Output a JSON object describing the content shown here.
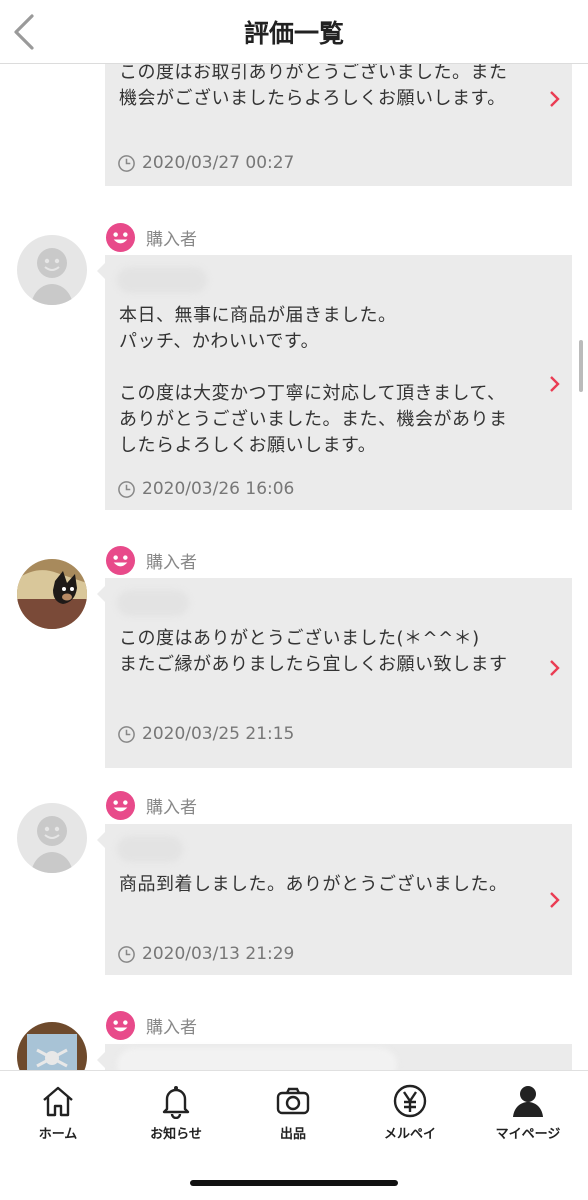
{
  "header": {
    "title": "評価一覧"
  },
  "reviews": [
    {
      "message": "この度はお取引ありがとうございました。また機会がございましたらよろしくお願いします。",
      "time": "2020/03/27 00:27"
    },
    {
      "role": "購入者",
      "message": "本日、無事に商品が届きました。\nパッチ、かわいいです。\n\nこの度は大変かつ丁寧に対応して頂きまして、ありがとうございました。また、機会がありましたらよろしくお願いします。",
      "time": "2020/03/26 16:06"
    },
    {
      "role": "購入者",
      "message": "この度はありがとうございました(＊^^＊)\nまたご縁がありましたら宜しくお願い致します",
      "time": "2020/03/25 21:15"
    },
    {
      "role": "購入者",
      "message": "商品到着しました。ありがとうございました。",
      "time": "2020/03/13 21:29"
    },
    {
      "role": "購入者"
    }
  ],
  "tabbar": {
    "items": [
      {
        "label": "ホーム",
        "icon": "home-icon"
      },
      {
        "label": "お知らせ",
        "icon": "bell-icon"
      },
      {
        "label": "出品",
        "icon": "camera-icon"
      },
      {
        "label": "メルペイ",
        "icon": "yen-icon"
      },
      {
        "label": "マイページ",
        "icon": "person-icon"
      }
    ]
  },
  "colors": {
    "accent": "#ea3c53",
    "bubble": "#ebebeb",
    "smile": "#e84a8a"
  }
}
